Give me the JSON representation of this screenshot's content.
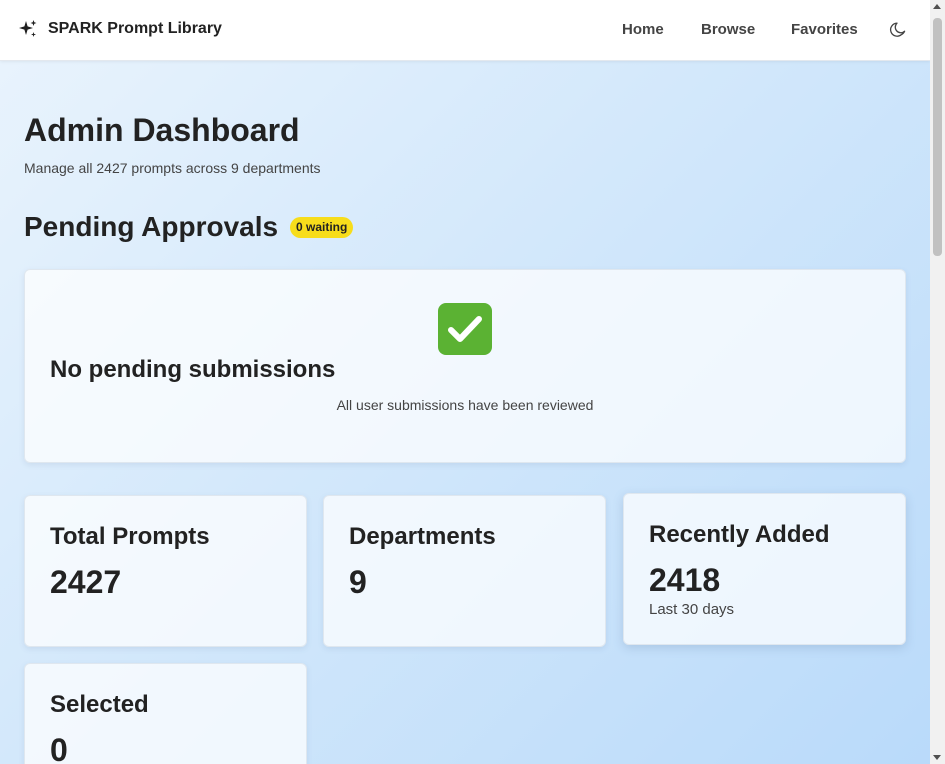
{
  "nav": {
    "brand": "SPARK Prompt Library",
    "brand_icon": "sparkles-icon",
    "links": [
      "Home",
      "Browse",
      "Favorites"
    ],
    "theme_icon": "moon-icon"
  },
  "header": {
    "title": "Admin Dashboard",
    "subtitle": "Manage all 2427 prompts across 9 departments"
  },
  "pending": {
    "title": "Pending Approvals",
    "badge": "0 waiting",
    "badge_color": "#f7dd1b",
    "empty_icon": "check-mark-icon",
    "empty_title": "No pending submissions",
    "empty_text": "All user submissions have been reviewed"
  },
  "stats": [
    {
      "label": "Total Prompts",
      "value": "2427",
      "note": ""
    },
    {
      "label": "Departments",
      "value": "9",
      "note": ""
    },
    {
      "label": "Recently Added",
      "value": "2418",
      "note": "Last 30 days"
    },
    {
      "label": "Selected",
      "value": "0",
      "note": ""
    }
  ]
}
